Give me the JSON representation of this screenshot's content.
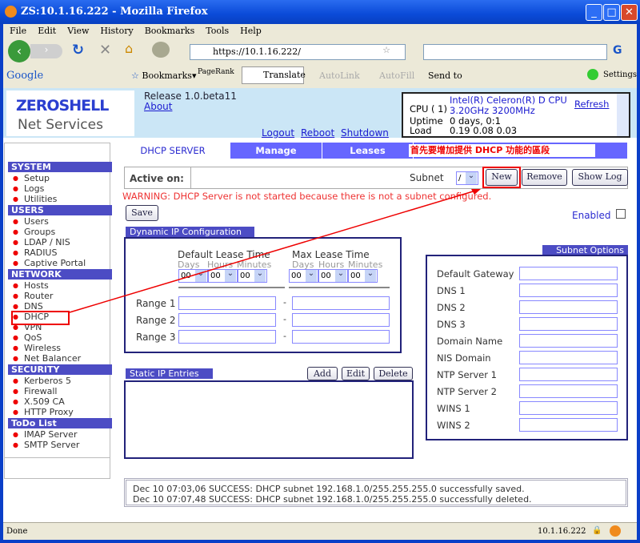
{
  "window": {
    "title": "ZS:10.1.16.222 - Mozilla Firefox"
  },
  "menu": [
    "File",
    "Edit",
    "View",
    "History",
    "Bookmarks",
    "Tools",
    "Help"
  ],
  "nav": {
    "url": "https://10.1.16.222/"
  },
  "bookmarks_bar": {
    "google": "Google",
    "bookmarks": "Bookmarks",
    "pagerank": "PageRank",
    "translate": "Translate",
    "autolink": "AutoLink",
    "autofill": "AutoFill",
    "sendto": "Send to",
    "settings": "Settings"
  },
  "header": {
    "logo_top": "ZEROSHELL",
    "logo_bottom": "Net Services",
    "release": "Release 1.0.beta11",
    "about": "About",
    "logout": "Logout",
    "reboot": "Reboot",
    "shutdown": "Shutdown",
    "cpu_label": "CPU ( 1)",
    "cpu_value": "Intel(R) Celeron(R) D CPU 3.20GHz 3200MHz",
    "refresh": "Refresh",
    "uptime_label": "Uptime",
    "uptime_value": "0 days, 0:1",
    "load_label": "Load",
    "load_value": "0.19 0.08 0.03"
  },
  "sidebar": [
    {
      "title": "SYSTEM",
      "items": [
        "Setup",
        "Logs",
        "Utilities"
      ]
    },
    {
      "title": "USERS",
      "items": [
        "Users",
        "Groups",
        "LDAP / NIS",
        "RADIUS",
        "Captive Portal"
      ]
    },
    {
      "title": "NETWORK",
      "items": [
        "Hosts",
        "Router",
        "DNS",
        "DHCP",
        "VPN",
        "QoS",
        "Wireless",
        "Net Balancer"
      ]
    },
    {
      "title": "SECURITY",
      "items": [
        "Kerberos 5",
        "Firewall",
        "X.509 CA",
        "HTTP Proxy"
      ]
    },
    {
      "title": "ToDo List",
      "items": [
        "IMAP Server",
        "SMTP Server"
      ]
    }
  ],
  "tabs": [
    "DHCP SERVER",
    "Manage",
    "Leases"
  ],
  "annotation": "首先要增加提供 DHCP 功能的區段",
  "active_on": {
    "label": "Active on:",
    "subnet_label": "Subnet",
    "subnet_value": "/",
    "new": "New",
    "remove": "Remove",
    "show_log": "Show Log"
  },
  "warning": "WARNING: DHCP Server is not started because there is not a subnet configured.",
  "save": "Save",
  "enabled": "Enabled",
  "dynamic": {
    "title": "Dynamic IP Configuration",
    "default_lease": "Default Lease Time",
    "max_lease": "Max Lease Time",
    "days": "Days",
    "hours": "Hours",
    "minutes": "Minutes",
    "zero": "00",
    "ranges": [
      "Range 1",
      "Range 2",
      "Range 3"
    ],
    "dash": "-"
  },
  "static": {
    "title": "Static IP Entries",
    "add": "Add",
    "edit": "Edit",
    "delete": "Delete"
  },
  "subnet_options": {
    "title": "Subnet Options",
    "fields": [
      "Default Gateway",
      "DNS 1",
      "DNS 2",
      "DNS 3",
      "Domain Name",
      "NIS Domain",
      "NTP Server 1",
      "NTP Server 2",
      "WINS 1",
      "WINS 2"
    ]
  },
  "log": [
    "Dec 10 07:03,06 SUCCESS: DHCP subnet 192.168.1.0/255.255.255.0 successfully saved.",
    "Dec 10 07:07,48 SUCCESS: DHCP subnet 192.168.1.0/255.255.255.0 successfully deleted."
  ],
  "status": {
    "text": "Done",
    "host": "10.1.16.222"
  }
}
